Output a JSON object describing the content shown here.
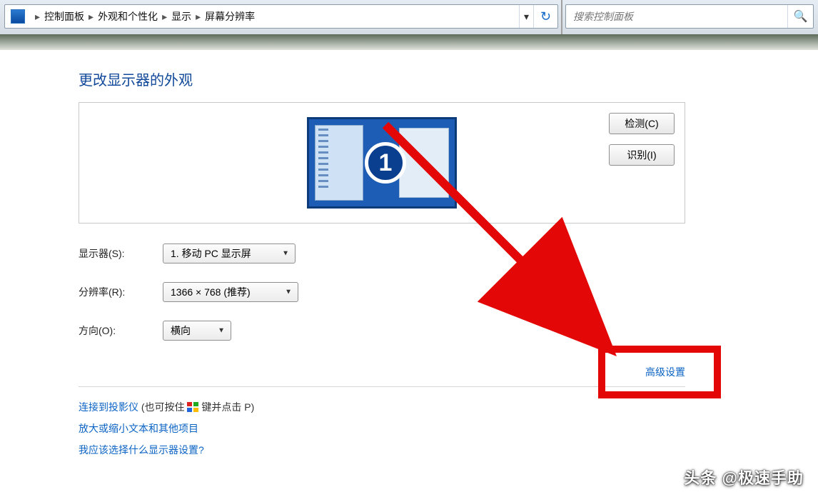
{
  "breadcrumb": {
    "root": "控制面板",
    "l2": "外观和个性化",
    "l3": "显示",
    "l4": "屏幕分辨率"
  },
  "search": {
    "placeholder": "搜索控制面板"
  },
  "title": "更改显示器的外观",
  "preview": {
    "number": "1"
  },
  "buttons": {
    "detect": "检测(C)",
    "identify": "识别(I)"
  },
  "form": {
    "display_label": "显示器(S):",
    "display_value": "1. 移动 PC 显示屏",
    "resolution_label": "分辨率(R):",
    "resolution_value": "1366 × 768 (推荐)",
    "orientation_label": "方向(O):",
    "orientation_value": "横向"
  },
  "advanced": "高级设置",
  "links": {
    "projector": "连接到投影仪",
    "projector_hint_a": " (也可按住 ",
    "projector_hint_b": " 键并点击 P)",
    "enlarge": "放大或缩小文本和其他项目",
    "which": "我应该选择什么显示器设置?"
  },
  "watermark": "头条 @极速手助"
}
